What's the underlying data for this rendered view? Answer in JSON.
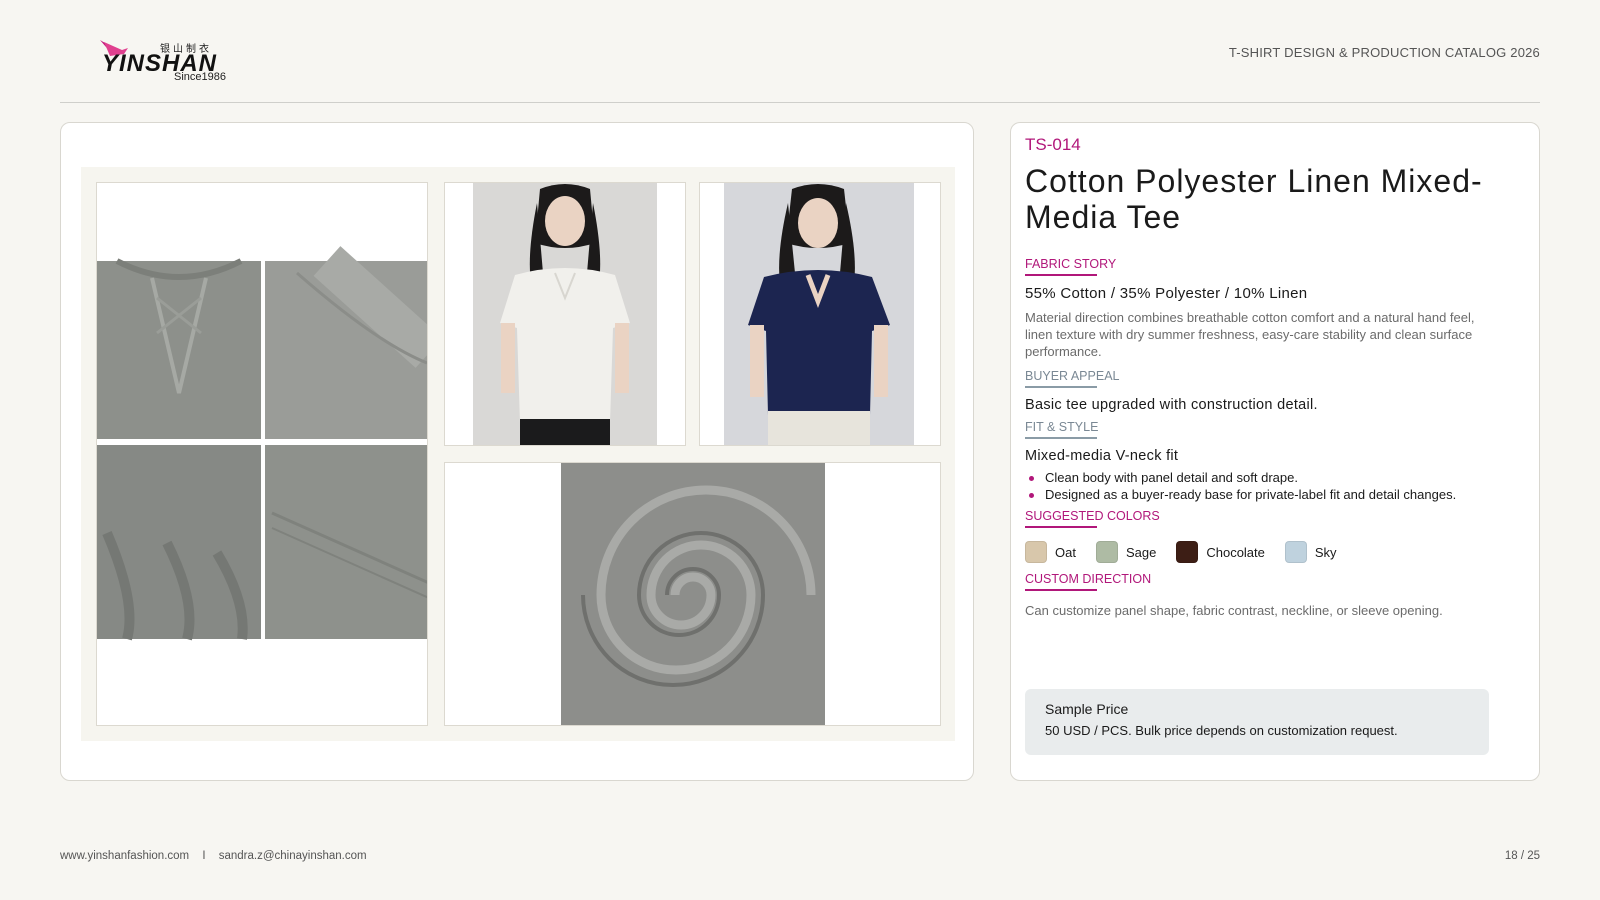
{
  "brand": {
    "name": "YINSHAN",
    "cn": "银山制衣",
    "since": "Since1986",
    "accent": "#b1177a"
  },
  "header": {
    "catalog_title": "T-SHIRT DESIGN & PRODUCTION CATALOG 2026"
  },
  "gallery": {
    "images": [
      "detail-collage-grey",
      "model-white-tee",
      "model-navy-tee",
      "fabric-swirl-grey"
    ]
  },
  "product": {
    "code": "TS-014",
    "title": "Cotton Polyester Linen Mixed-Media Tee",
    "fabric_story": {
      "label": "FABRIC STORY",
      "composition": "55% Cotton / 35% Polyester / 10% Linen",
      "description": "Material direction combines breathable cotton comfort and a natural hand feel, linen texture with dry summer freshness, easy-care stability and clean surface performance."
    },
    "buyer_appeal": {
      "label": "BUYER APPEAL",
      "text": "Basic tee upgraded with construction detail."
    },
    "fit_style": {
      "label": "FIT & STYLE",
      "headline": "Mixed-media V-neck fit",
      "bullets": [
        "Clean body with panel detail and soft drape.",
        "Designed as a buyer-ready base for private-label fit and detail changes."
      ]
    },
    "suggested_colors": {
      "label": "SUGGESTED COLORS",
      "colors": [
        {
          "name": "Oat",
          "hex": "#d8c7ab"
        },
        {
          "name": "Sage",
          "hex": "#aebba4"
        },
        {
          "name": "Chocolate",
          "hex": "#3d1e15"
        },
        {
          "name": "Sky",
          "hex": "#bfd2de"
        }
      ]
    },
    "custom_direction": {
      "label": "CUSTOM DIRECTION",
      "text": "Can customize panel shape, fabric contrast, neckline, or sleeve opening."
    },
    "price": {
      "label": "Sample Price",
      "value": "50 USD / PCS. Bulk price depends on customization request."
    }
  },
  "footer": {
    "website": "www.yinshanfashion.com",
    "separator": "I",
    "email": "sandra.z@chinayinshan.com",
    "page": "18 / 25"
  }
}
